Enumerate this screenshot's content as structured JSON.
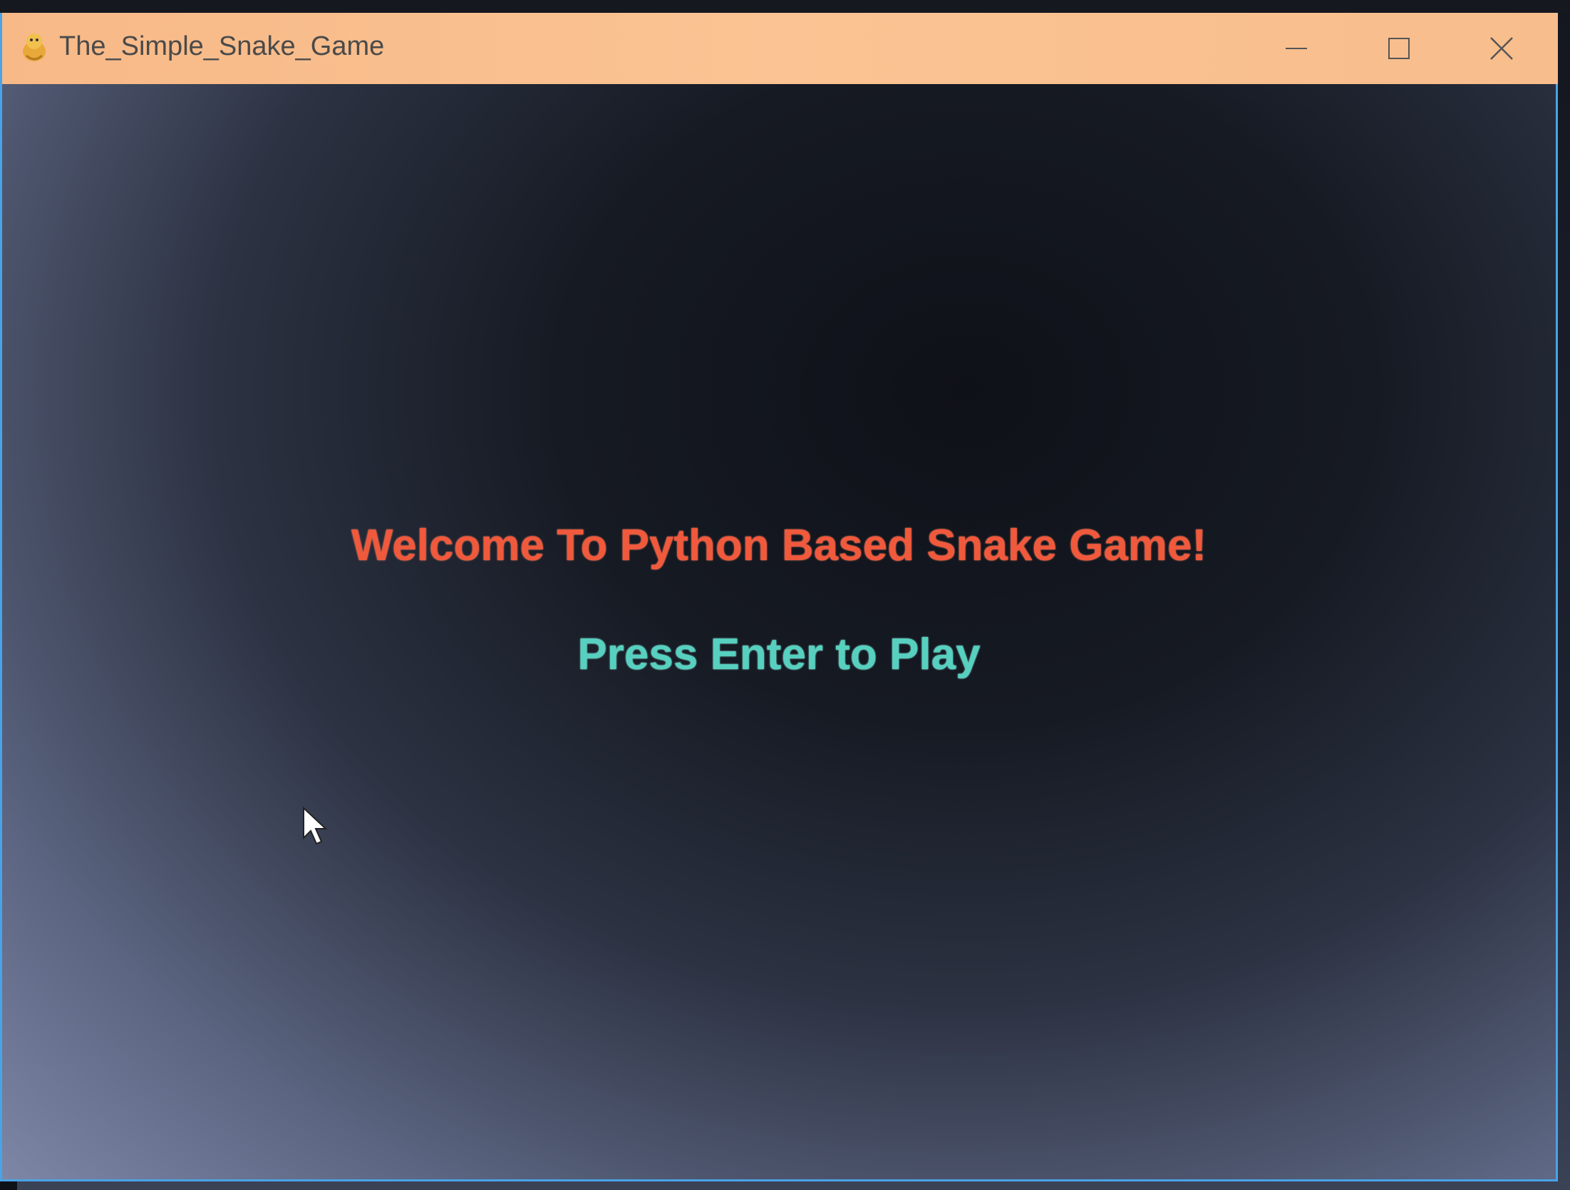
{
  "window": {
    "title": "The_Simple_Snake_Game",
    "titlebar_color": "#f9bf8f",
    "border_color": "#4aa3e8",
    "controls": {
      "minimize_icon": "minimize-icon",
      "maximize_icon": "maximize-icon",
      "close_icon": "close-icon"
    }
  },
  "game": {
    "welcome_text": "Welcome To Python Based Snake Game!",
    "welcome_color": "#f0593c",
    "prompt_text": "Press Enter to Play",
    "prompt_color": "#57d0c0"
  }
}
